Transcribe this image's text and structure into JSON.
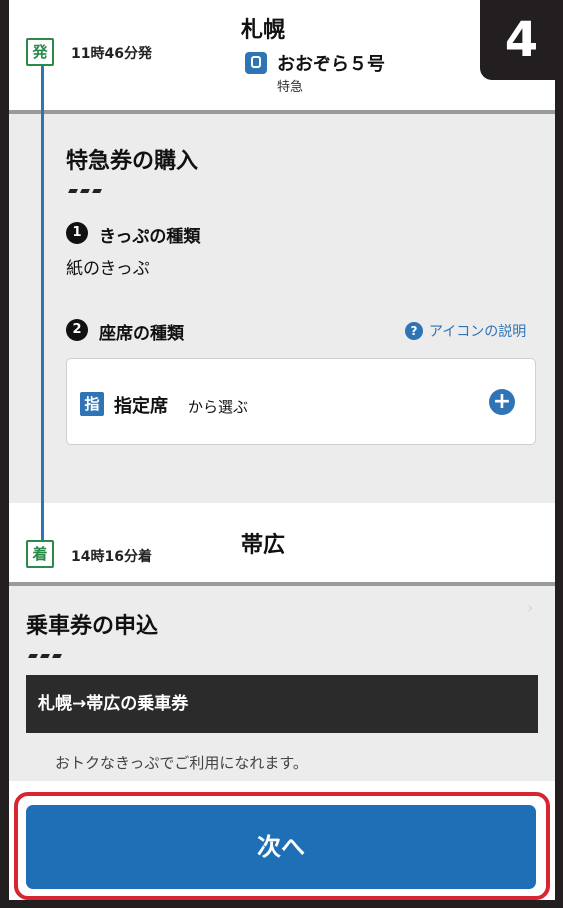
{
  "step_number": "4",
  "departure": {
    "badge": "発",
    "time": "11時46分発",
    "station": "札幌",
    "train_icon": "train-icon",
    "train_name": "おおぞら５号",
    "train_type": "特急"
  },
  "express_section": {
    "title": "特急券の購入",
    "ticket_type": {
      "number": "1",
      "label": "きっぷの種類",
      "value": "紙のきっぷ"
    },
    "seat_type": {
      "number": "2",
      "label": "座席の種類",
      "help_label": "アイコンの説明",
      "help_icon": "?"
    },
    "seat_option": {
      "badge": "指",
      "label_strong": "指定席",
      "label_suffix": "から選ぶ",
      "add_icon": "+"
    }
  },
  "arrival": {
    "badge": "着",
    "time": "14時16分着",
    "station": "帯広"
  },
  "fare_section": {
    "title": "乗車券の申込",
    "fare_bar": "札幌→帯広の乗車券",
    "note": "おトクなきっぷでご利用になれます。",
    "chevron": "›"
  },
  "next_button": "次へ",
  "colors": {
    "accent": "#1e6fb5",
    "highlight": "#d7262f",
    "station_badge": "#2a8a4a"
  }
}
